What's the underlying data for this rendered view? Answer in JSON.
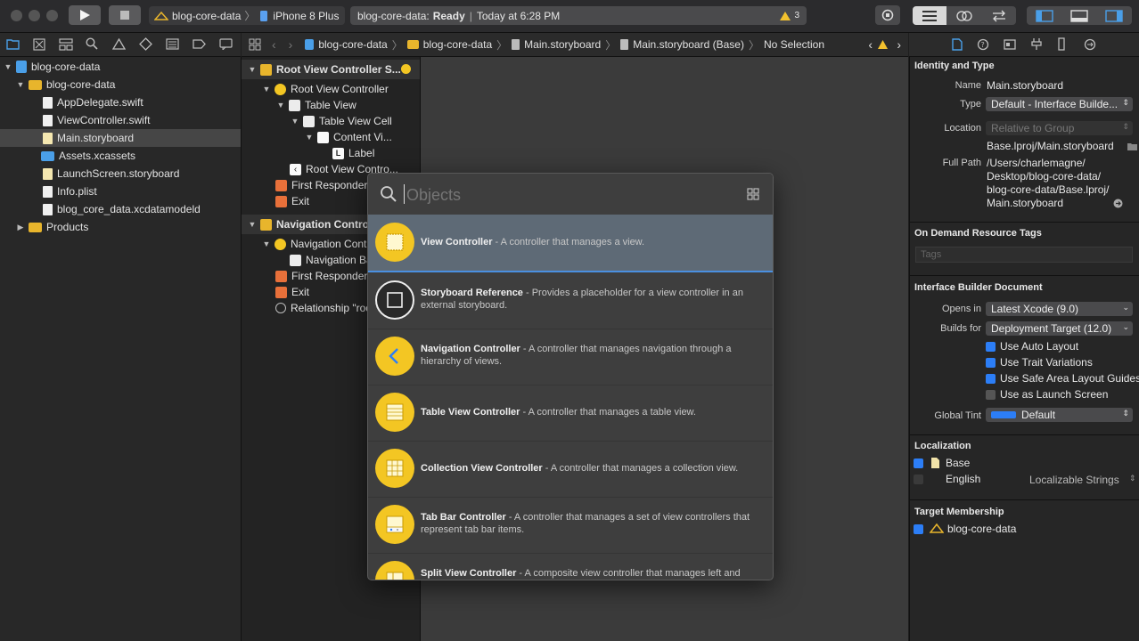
{
  "toolbar": {
    "scheme_target": "blog-core-data",
    "device": "iPhone 8 Plus",
    "status_project": "blog-core-data:",
    "status_state": "Ready",
    "status_time": "Today at 6:28 PM",
    "warning_count": "3"
  },
  "navigator": {
    "items": [
      {
        "label": "blog-core-data"
      },
      {
        "label": "blog-core-data"
      },
      {
        "label": "AppDelegate.swift"
      },
      {
        "label": "ViewController.swift"
      },
      {
        "label": "Main.storyboard"
      },
      {
        "label": "Assets.xcassets"
      },
      {
        "label": "LaunchScreen.storyboard"
      },
      {
        "label": "Info.plist"
      },
      {
        "label": "blog_core_data.xcdatamodeld"
      },
      {
        "label": "Products"
      }
    ]
  },
  "jumpbar": {
    "crumbs": [
      "blog-core-data",
      "blog-core-data",
      "Main.storyboard",
      "Main.storyboard (Base)",
      "No Selection"
    ]
  },
  "outline": {
    "items": [
      {
        "label": "Root View Controller S..."
      },
      {
        "label": "Root View Controller"
      },
      {
        "label": "Table View"
      },
      {
        "label": "Table View Cell"
      },
      {
        "label": "Content Vi..."
      },
      {
        "label": "Label"
      },
      {
        "label": "Root View Contro..."
      },
      {
        "label": "First Responder"
      },
      {
        "label": "Exit"
      },
      {
        "label": "Navigation Controll..."
      },
      {
        "label": "Navigation Cont..."
      },
      {
        "label": "Navigation Ba..."
      },
      {
        "label": "First Responder"
      },
      {
        "label": "Exit"
      },
      {
        "label": "Relationship \"roo..."
      }
    ]
  },
  "library": {
    "search_placeholder": "Objects",
    "items": [
      {
        "title": "View Controller",
        "desc": " - A controller that manages a view."
      },
      {
        "title": "Storyboard Reference",
        "desc": " - Provides a placeholder for a view controller in an external storyboard."
      },
      {
        "title": "Navigation Controller",
        "desc": " - A controller that manages navigation through a hierarchy of views."
      },
      {
        "title": "Table View Controller",
        "desc": " - A controller that manages a table view."
      },
      {
        "title": "Collection View Controller",
        "desc": " - A controller that manages a collection view."
      },
      {
        "title": "Tab Bar Controller",
        "desc": " - A controller that manages a set of view controllers that represent tab bar items."
      },
      {
        "title": "Split View Controller",
        "desc": " - A composite view controller that manages left and"
      }
    ]
  },
  "inspector": {
    "identity_header": "Identity and Type",
    "name_label": "Name",
    "name_value": "Main.storyboard",
    "type_label": "Type",
    "type_value": "Default - Interface Builde...",
    "location_label": "Location",
    "location_value": "Relative to Group",
    "location_path": "Base.lproj/Main.storyboard",
    "fullpath_label": "Full Path",
    "fullpath_lines": [
      "/Users/charlemagne/",
      "Desktop/blog-core-data/",
      "blog-core-data/Base.lproj/",
      "Main.storyboard"
    ],
    "odr_header": "On Demand Resource Tags",
    "tags_placeholder": "Tags",
    "ibdoc_header": "Interface Builder Document",
    "opens_label": "Opens in",
    "opens_value": "Latest Xcode (9.0)",
    "builds_label": "Builds for",
    "builds_value": "Deployment Target (12.0)",
    "checks": [
      {
        "label": "Use Auto Layout",
        "checked": true
      },
      {
        "label": "Use Trait Variations",
        "checked": true
      },
      {
        "label": "Use Safe Area Layout Guides",
        "checked": true
      },
      {
        "label": "Use as Launch Screen",
        "checked": false
      }
    ],
    "tint_label": "Global Tint",
    "tint_value": "Default",
    "loc_header": "Localization",
    "loc_base": "Base",
    "loc_english": "English",
    "loc_strings": "Localizable Strings",
    "target_header": "Target Membership",
    "target_name": "blog-core-data"
  },
  "colors": {
    "accent": "#2c7ef7",
    "folder": "#e8b52c",
    "library_icon": "#f3c623"
  }
}
